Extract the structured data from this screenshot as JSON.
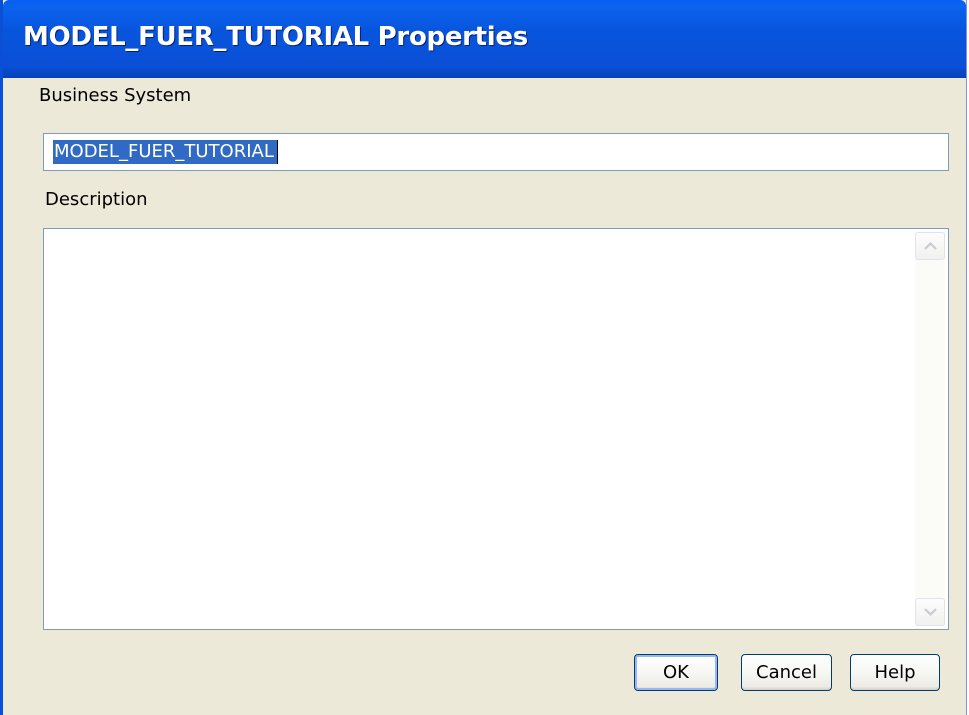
{
  "window": {
    "title": "MODEL_FUER_TUTORIAL Properties"
  },
  "form": {
    "business_system_label": "Business System",
    "business_system_value": "MODEL_FUER_TUTORIAL",
    "description_label": "Description",
    "description_value": ""
  },
  "buttons": {
    "ok": "OK",
    "cancel": "Cancel",
    "help": "Help"
  },
  "icons": {
    "scroll_up": "chevron-up-icon",
    "scroll_down": "chevron-down-icon"
  },
  "colors": {
    "titlebar": "#0a4fd6",
    "dialog_background": "#ece9d8",
    "selection": "#316ac5",
    "field_border": "#7f9db9"
  }
}
